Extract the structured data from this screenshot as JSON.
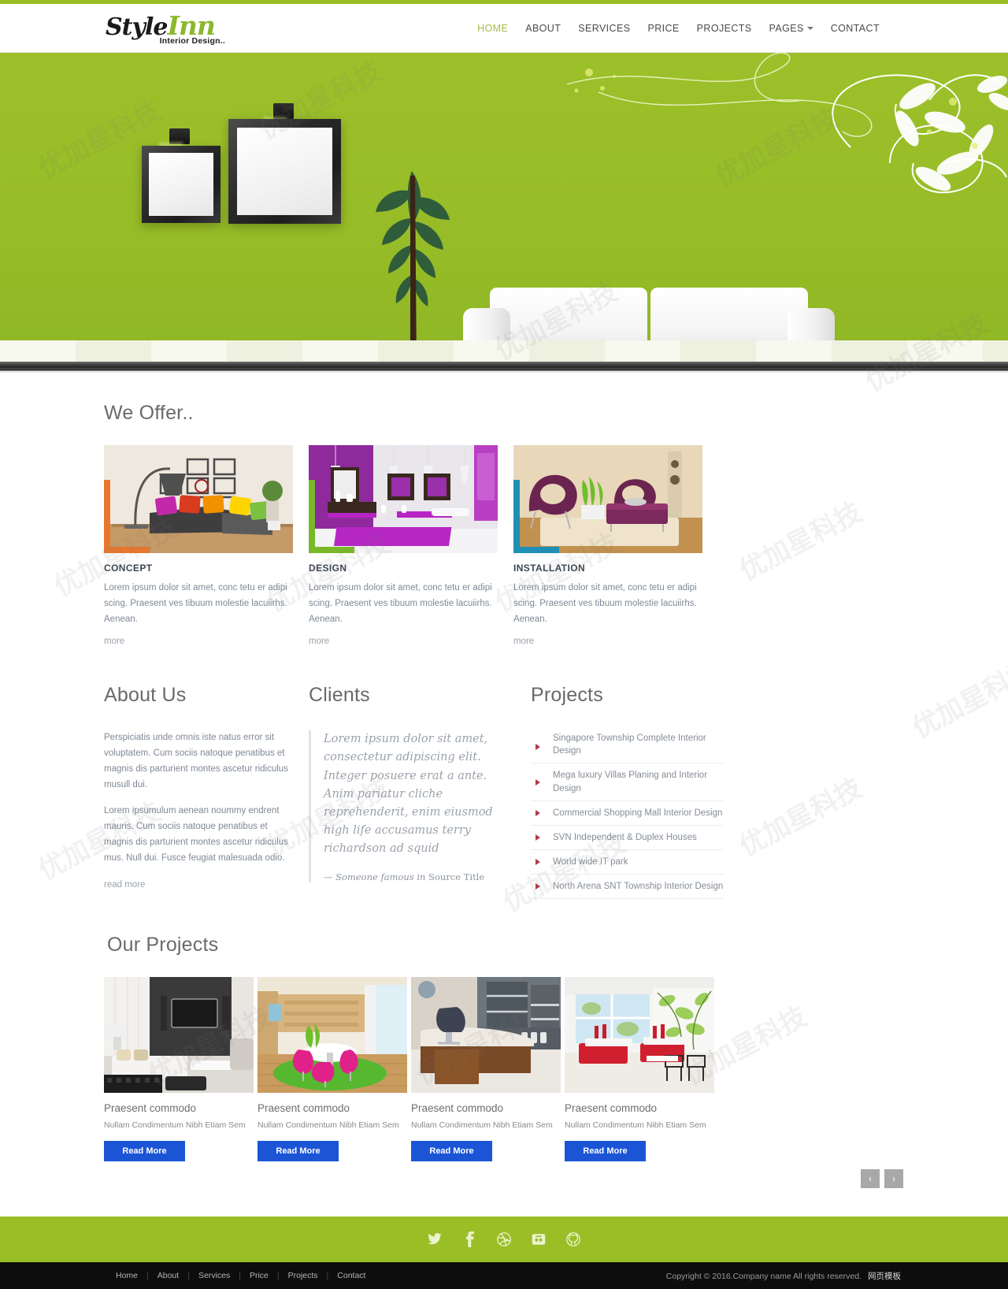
{
  "brand": {
    "name_part1": "Style",
    "name_part2": "Inn",
    "tagline": "Interior Design..",
    "accent_color": "#9ABE26"
  },
  "nav": {
    "items": [
      {
        "label": "HOME",
        "active": true
      },
      {
        "label": "ABOUT",
        "active": false
      },
      {
        "label": "SERVICES",
        "active": false
      },
      {
        "label": "PRICE",
        "active": false
      },
      {
        "label": "PROJECTS",
        "active": false
      },
      {
        "label": "PAGES",
        "active": false,
        "dropdown": true
      },
      {
        "label": "CONTACT",
        "active": false
      }
    ]
  },
  "offer": {
    "title": "We Offer..",
    "cards": [
      {
        "heading": "CONCEPT",
        "body": "Lorem ipsum dolor sit amet, conc tetu er adipi scing. Praesent ves tibuum molestie lacuiirhs. Aenean.",
        "more": "more",
        "accent": "#E8762C",
        "image": "living-room-with-grey-sofa-and-colorful-cushions"
      },
      {
        "heading": "DESIGN",
        "body": "Lorem ipsum dolor sit amet, conc tetu er adipi scing. Praesent ves tibuum molestie lacuiirhs. Aenean.",
        "more": "more",
        "accent": "#78B829",
        "image": "purple-bathroom-with-mirrors"
      },
      {
        "heading": "INSTALLATION",
        "body": "Lorem ipsum dolor sit amet, conc tetu er adipi scing. Praesent ves tibuum molestie lacuiirhs. Aenean.",
        "more": "more",
        "accent": "#1F8FB5",
        "image": "lounge-with-purple-chairs-and-ottoman"
      }
    ]
  },
  "about": {
    "title": "About Us",
    "paragraph1": "Perspiciatis unde omnis iste natus error sit voluptatem. Cum sociis natoque penatibus et magnis dis parturient montes ascetur ridiculus musull dui.",
    "paragraph2": "Lorem ipsumulum aenean noummy endrent mauris. Cum sociis natoque penatibus et magnis dis parturient montes ascetur ridiculus mus. Null dui. Fusce feugiat malesuada odio.",
    "read_more": "read more"
  },
  "clients": {
    "title": "Clients",
    "quote": "Lorem ipsum dolor sit amet, consectetur adipiscing elit. Integer posuere erat a ante. Anim pariatur cliche reprehenderit, enim eiusmod high life accusamus terry richardson ad squid",
    "attribution_dash": "— ",
    "attribution_name": "Someone famous in ",
    "attribution_source": "Source Title"
  },
  "projects_list": {
    "title": "Projects",
    "items": [
      "Singapore Township Complete Interior Design",
      "Mega luxury Villas Planing and Interior Design",
      "Commercial Shopping Mall Interior Design",
      "SVN Independent & Duplex Houses",
      "World wide IT park",
      "North Arena SNT Township Interior Design"
    ]
  },
  "our_projects": {
    "title": "Our Projects",
    "cards": [
      {
        "title": "Praesent commodo",
        "subtitle": "Nullam Condimentum Nibh Etiam Sem",
        "button": "Read More",
        "image": "modern-living-room-with-tv-on-dark-stone-wall"
      },
      {
        "title": "Praesent commodo",
        "subtitle": "Nullam Condimentum Nibh Etiam Sem",
        "button": "Read More",
        "image": "dining-area-with-pink-chairs-on-green-rug"
      },
      {
        "title": "Praesent commodo",
        "subtitle": "Nullam Condimentum Nibh Etiam Sem",
        "button": "Read More",
        "image": "executive-office-with-wooden-desk"
      },
      {
        "title": "Praesent commodo",
        "subtitle": "Nullam Condimentum Nibh Etiam Sem",
        "button": "Read More",
        "image": "cafeteria-with-red-booths-and-plant-mural"
      }
    ],
    "pager": {
      "prev": "‹",
      "next": "›"
    },
    "button_color": "#1B55D6"
  },
  "social": {
    "items": [
      "twitter-icon",
      "facebook-icon",
      "dribbble-icon",
      "flickr-icon",
      "github-icon"
    ],
    "bar_color": "#9ABE26"
  },
  "footer": {
    "links": [
      "Home",
      "About",
      "Services",
      "Price",
      "Projects",
      "Contact"
    ],
    "separator": "|",
    "copyright": "Copyright © 2016.Company name All rights reserved.",
    "cn_label": "网页模板"
  },
  "hero": {
    "background_color": "#96BC27",
    "elements": [
      "wall-picture-frame-small",
      "wall-picture-frame-large",
      "spotlight",
      "potted-plant",
      "white-sofa",
      "floral-line-art"
    ]
  }
}
